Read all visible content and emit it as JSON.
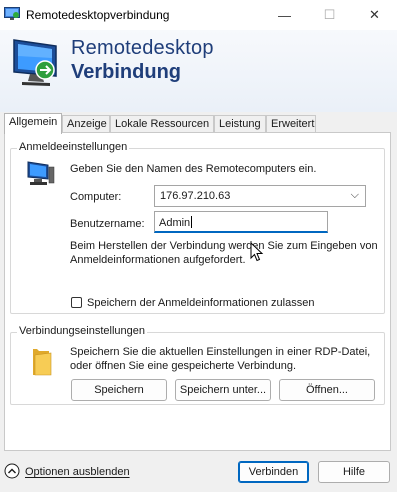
{
  "window": {
    "title": "Remotedesktopverbindung",
    "minimize_glyph": "—",
    "maximize_glyph": "☐",
    "close_glyph": "✕"
  },
  "banner": {
    "line1": "Remotedesktop",
    "line2": "Verbindung"
  },
  "tabs": [
    {
      "label": "Allgemein",
      "active": true
    },
    {
      "label": "Anzeige",
      "active": false
    },
    {
      "label": "Lokale Ressourcen",
      "active": false
    },
    {
      "label": "Leistung",
      "active": false
    },
    {
      "label": "Erweitert",
      "active": false
    }
  ],
  "logon": {
    "group_label": "Anmeldeeinstellungen",
    "intro": "Geben Sie den Namen des Remotecomputers ein.",
    "computer_label": "Computer:",
    "computer_value": "176.97.210.63",
    "username_label": "Benutzername:",
    "username_value": "Admin",
    "note_line1": "Beim Herstellen der Verbindung werden Sie zum Eingeben von",
    "note_line2": "Anmeldeinformationen aufgefordert.",
    "save_credentials_label": "Speichern der Anmeldeinformationen zulassen",
    "save_credentials_checked": false
  },
  "connection": {
    "group_label": "Verbindungseinstellungen",
    "text_line1": "Speichern Sie die aktuellen Einstellungen in einer RDP-Datei,",
    "text_line2": "oder öffnen Sie eine gespeicherte Verbindung.",
    "save_button": "Speichern",
    "save_as_button": "Speichern unter...",
    "open_button": "Öffnen..."
  },
  "footer": {
    "options_toggle": "Optionen ausblenden",
    "connect_button": "Verbinden",
    "help_button": "Hilfe"
  },
  "icons": {
    "app": "remote-desktop-icon",
    "banner": "remote-desktop-monitor-icon",
    "computer": "computer-icon",
    "folder": "folder-icon",
    "toggle": "chevron-up-circle-icon"
  },
  "colors": {
    "banner_text": "#1f3e7a",
    "accent": "#0067c0"
  }
}
